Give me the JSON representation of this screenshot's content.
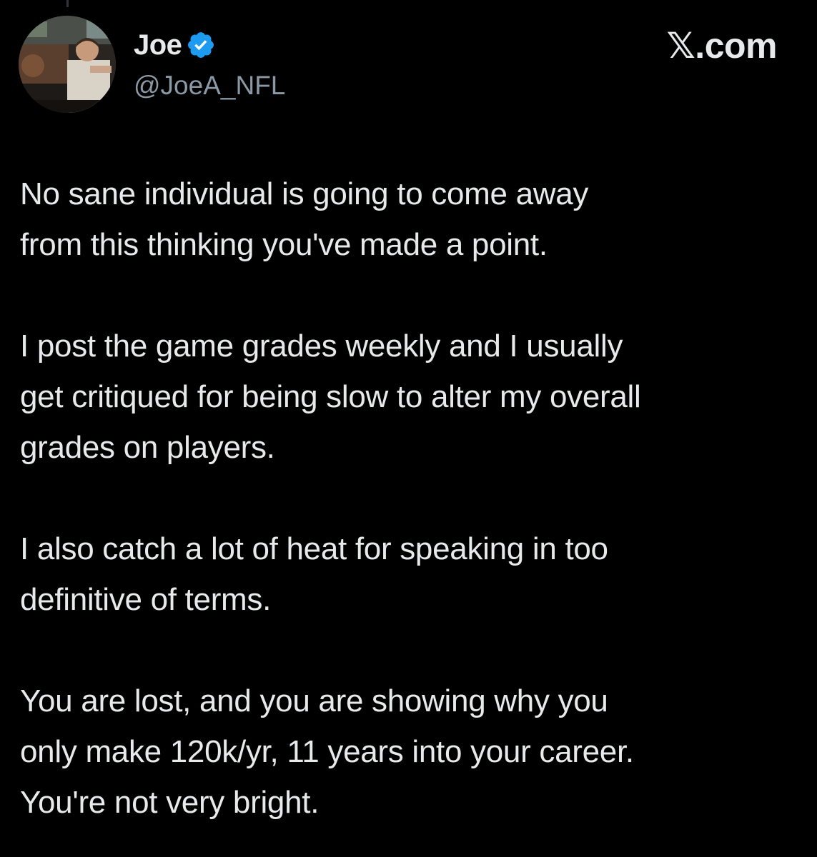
{
  "author": {
    "display_name": "Joe",
    "handle": "@JoeA_NFL",
    "avatar_icon": "profile-photo",
    "verified_icon": "verified-badge-icon",
    "verified_color": "#1d9bf0"
  },
  "brand": {
    "label": "𝕏.com"
  },
  "tweet": {
    "paragraphs": [
      "No sane individual is going to come away\nfrom this thinking you've made a point.",
      "I post the game grades weekly and I usually\nget critiqued for being slow to alter my overall\ngrades on players.",
      "I also catch a lot of heat for speaking in too\ndefinitive of terms.",
      "You are lost, and you are showing why you\nonly make 120k/yr, 11 years into your career.\nYou're not very bright."
    ]
  },
  "colors": {
    "background": "#000000",
    "text_primary": "#e7e9ea",
    "text_secondary": "#8b98a5"
  }
}
